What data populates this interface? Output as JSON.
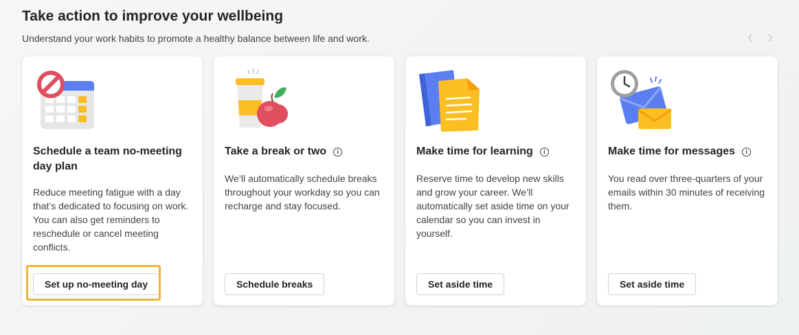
{
  "header": {
    "title": "Take action to improve your wellbeing",
    "subtitle": "Understand your work habits to promote a healthy balance between life and work."
  },
  "carousel": {
    "prev_icon": "chevron-left-icon",
    "next_icon": "chevron-right-icon"
  },
  "cards": [
    {
      "icon": "no-meeting-calendar-icon",
      "title": "Schedule a team no-meeting day plan",
      "description": "Reduce meeting fatigue with a day that’s dedicated to focusing on work. You can also get reminders to reschedule or cancel meeting conflicts.",
      "button": "Set up no-meeting day"
    },
    {
      "icon": "coffee-apple-icon",
      "title": "Take a break or two",
      "description": "We’ll automatically schedule breaks throughout your workday so you can recharge and stay focused.",
      "button": "Schedule breaks"
    },
    {
      "icon": "notebook-icon",
      "title": "Make time for learning",
      "description": "Reserve time to develop new skills and grow your career. We’ll automatically set aside time on your calendar so you can invest in yourself.",
      "button": "Set aside time"
    },
    {
      "icon": "clock-mail-icon",
      "title": "Make time for messages",
      "description": "You read over three-quarters of your emails within 30 minutes of receiving them.",
      "button": "Set aside time"
    }
  ],
  "colors": {
    "focus": "#f2b33b",
    "accent_blue": "#5b7ff0",
    "accent_yellow": "#fbbf24",
    "red": "#e04f5f"
  }
}
